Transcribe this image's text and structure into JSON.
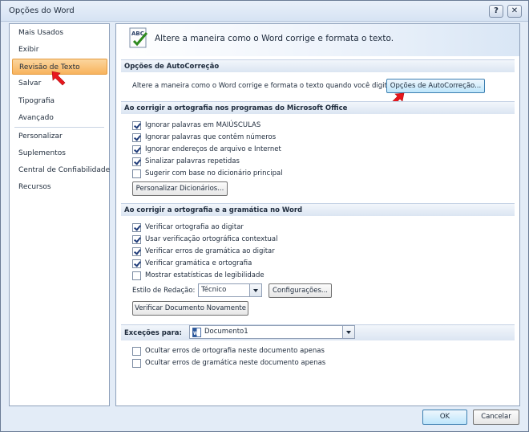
{
  "window": {
    "title": "Opções do Word",
    "help_glyph": "?",
    "close_glyph": "✕"
  },
  "sidebar": {
    "items": [
      {
        "label": "Mais Usados"
      },
      {
        "label": "Exibir"
      },
      {
        "label": "Revisão de Texto",
        "selected": true
      },
      {
        "label": "Salvar"
      },
      {
        "label": "Tipografia"
      },
      {
        "label": "Avançado"
      },
      {
        "label": "Personalizar"
      },
      {
        "label": "Suplementos"
      },
      {
        "label": "Central de Confiabilidade"
      },
      {
        "label": "Recursos"
      }
    ]
  },
  "banner": {
    "icon": "abc-check-icon",
    "icon_text": "ABC",
    "text": "Altere a maneira como o Word corrige e formata o texto."
  },
  "autocorrect": {
    "header": "Opções de AutoCorreção",
    "description": "Altere a maneira como o Word corrige e formata o texto quando você digita:",
    "button": "Opções de AutoCorreção..."
  },
  "office_spelling": {
    "header": "Ao corrigir a ortografia nos programas do Microsoft Office",
    "options": [
      {
        "label": "Ignorar palavras em MAIÚSCULAS",
        "checked": true
      },
      {
        "label": "Ignorar palavras que contêm números",
        "checked": true
      },
      {
        "label": "Ignorar endereços de arquivo e Internet",
        "checked": true
      },
      {
        "label": "Sinalizar palavras repetidas",
        "checked": true
      },
      {
        "label": "Sugerir com base no dicionário principal",
        "checked": false
      }
    ],
    "button": "Personalizar Dicionários..."
  },
  "word_spelling": {
    "header": "Ao corrigir a ortografia e a gramática no Word",
    "options": [
      {
        "label": "Verificar ortografia ao digitar",
        "checked": true
      },
      {
        "label": "Usar verificação ortográfica contextual",
        "checked": true
      },
      {
        "label": "Verificar erros de gramática ao digitar",
        "checked": true
      },
      {
        "label": "Verificar gramática e ortografia",
        "checked": true
      },
      {
        "label": "Mostrar estatísticas de legibilidade",
        "checked": false
      }
    ],
    "style_label": "Estilo de Redação:",
    "style_value": "Técnico",
    "settings_button": "Configurações...",
    "recheck_button": "Verificar Documento Novamente"
  },
  "exceptions": {
    "label": "Exceções para:",
    "document": "Documento1",
    "options": [
      {
        "label": "Ocultar erros de ortografia neste documento apenas",
        "checked": false
      },
      {
        "label": "Ocultar erros de gramática neste documento apenas",
        "checked": false
      }
    ]
  },
  "footer": {
    "ok": "OK",
    "cancel": "Cancelar"
  },
  "colors": {
    "selected_nav": "#f8b35d",
    "marker_red": "#e8161c"
  }
}
